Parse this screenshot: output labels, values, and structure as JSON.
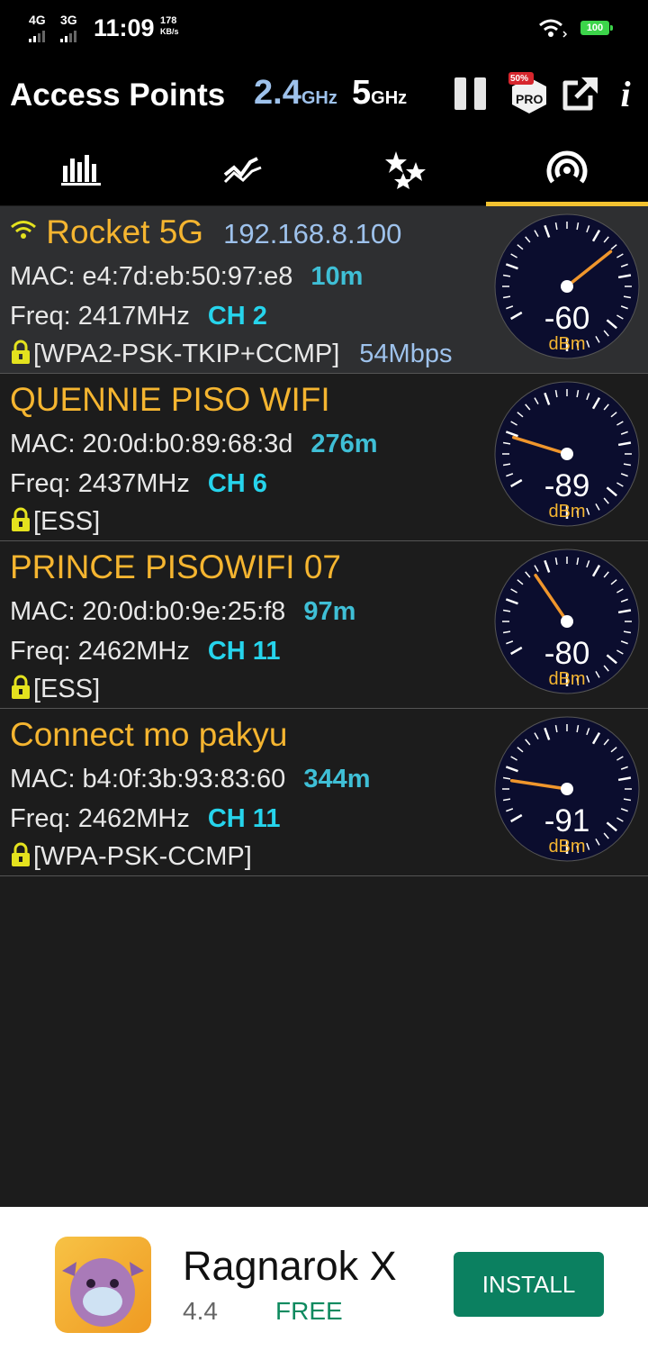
{
  "status_bar": {
    "net1_label": "4G",
    "net2_label": "3G",
    "time": "11:09",
    "speed_value": "178",
    "speed_unit": "KB/s",
    "battery": "100"
  },
  "app_bar": {
    "title": "Access Points",
    "band_24": "2.4",
    "band_5": "5",
    "ghz_unit": "GHz",
    "pro_badge": "PRO",
    "pro_discount": "50%",
    "info_label": "i"
  },
  "tabs": [
    {
      "name": "channel-graph",
      "icon": "bar-chart-icon"
    },
    {
      "name": "time-graph",
      "icon": "line-chart-icon"
    },
    {
      "name": "channel-rating",
      "icon": "stars-icon"
    },
    {
      "name": "access-points",
      "icon": "wifi-signal-icon",
      "active": true
    }
  ],
  "access_points": [
    {
      "ssid": "Rocket 5G",
      "ip": "192.168.8.100",
      "connected": true,
      "mac_line": "MAC: e4:7d:eb:50:97:e8",
      "distance": "10m",
      "freq_line": "Freq: 2417MHz",
      "channel": "CH 2",
      "security": "[WPA2-PSK-TKIP+CCMP]",
      "rate": "54Mbps",
      "level": "-60",
      "dbm": -60,
      "unit": "dBm"
    },
    {
      "ssid": "QUENNIE PISO WIFI",
      "mac_line": "MAC: 20:0d:b0:89:68:3d",
      "distance": "276m",
      "freq_line": "Freq: 2437MHz",
      "channel": "CH 6",
      "security": "[ESS]",
      "level": "-89",
      "dbm": -89,
      "unit": "dBm"
    },
    {
      "ssid": "PRINCE PISOWIFI 07",
      "mac_line": "MAC: 20:0d:b0:9e:25:f8",
      "distance": "97m",
      "freq_line": "Freq: 2462MHz",
      "channel": "CH 11",
      "security": "[ESS]",
      "level": "-80",
      "dbm": -80,
      "unit": "dBm"
    },
    {
      "ssid": "Connect mo pakyu",
      "mac_line": "MAC: b4:0f:3b:93:83:60",
      "distance": "344m",
      "freq_line": "Freq: 2462MHz",
      "channel": "CH 11",
      "security": "[WPA-PSK-CCMP]",
      "level": "-91",
      "dbm": -91,
      "unit": "dBm"
    }
  ],
  "ad": {
    "title": "Ragnarok X",
    "rating": "4.4",
    "price": "FREE",
    "button": "INSTALL"
  },
  "colors": {
    "ssid": "#f5b530",
    "accent_blue": "#9ec2ec",
    "channel_cyan": "#26d4ec",
    "tab_indicator": "#f2c230",
    "needle": "#f0962c",
    "install_button": "#0b8060"
  }
}
